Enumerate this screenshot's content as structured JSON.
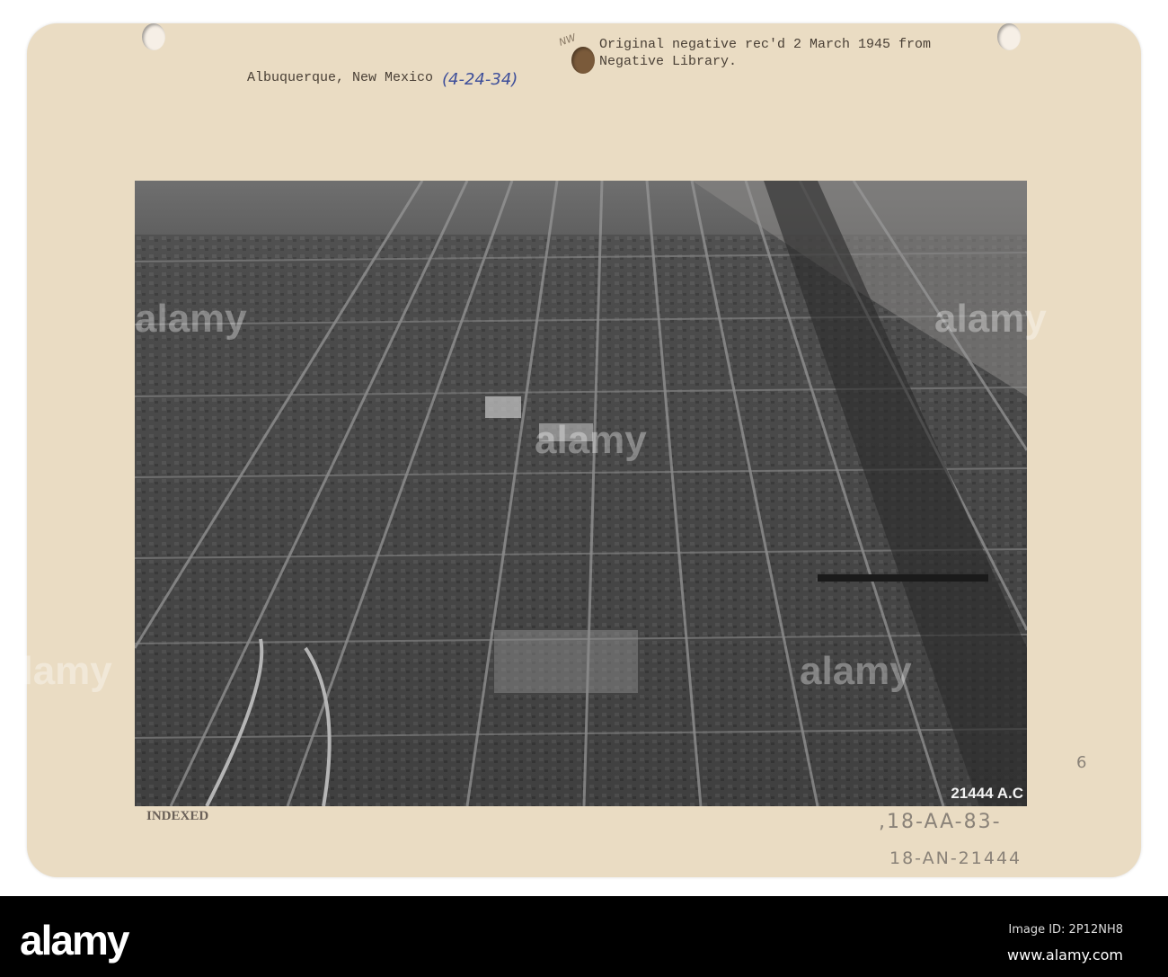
{
  "card": {
    "location_caption": "Albuquerque, New Mexico",
    "handwritten_date": "(4-24-34)",
    "note_line1": "Original negative rec'd 2 March 1945 from",
    "note_line2": "Negative Library.",
    "initials": "NW",
    "indexed_stamp": "INDEXED",
    "photo_number": "21444 A.C",
    "pencil_ref1": ",18-AA-83-",
    "pencil_ref2": "18-AN-21444",
    "pencil_mark": "6"
  },
  "watermark": {
    "text": "alamy"
  },
  "footer": {
    "logo": "alamy",
    "image_id": "Image ID: 2P12NH8",
    "url": "www.alamy.com"
  }
}
